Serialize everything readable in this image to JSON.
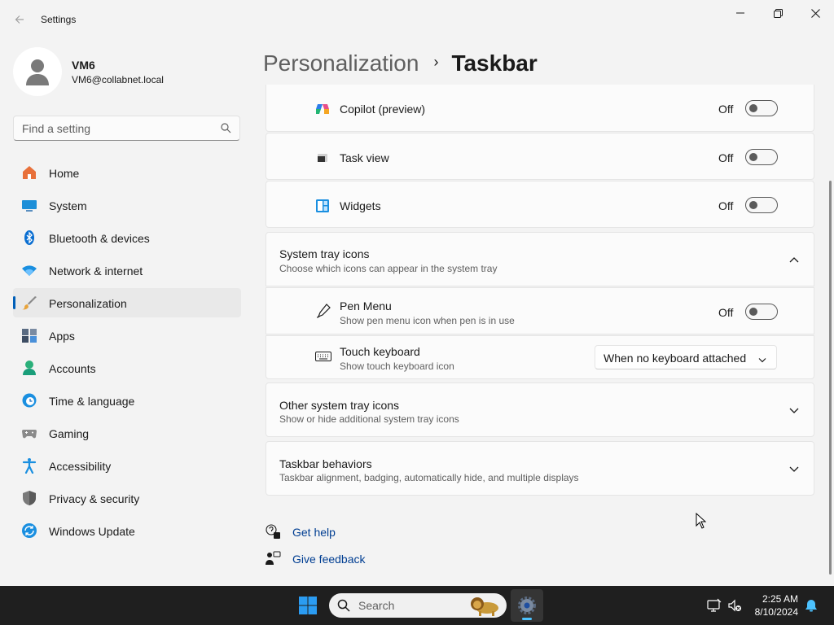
{
  "window": {
    "title": "Settings"
  },
  "profile": {
    "name": "VM6",
    "email": "VM6@collabnet.local"
  },
  "search": {
    "placeholder": "Find a setting"
  },
  "nav": {
    "items": [
      {
        "label": "Home",
        "icon": "home-icon"
      },
      {
        "label": "System",
        "icon": "system-icon"
      },
      {
        "label": "Bluetooth & devices",
        "icon": "bluetooth-icon"
      },
      {
        "label": "Network & internet",
        "icon": "wifi-icon"
      },
      {
        "label": "Personalization",
        "icon": "brush-icon",
        "active": true
      },
      {
        "label": "Apps",
        "icon": "apps-icon"
      },
      {
        "label": "Accounts",
        "icon": "accounts-icon"
      },
      {
        "label": "Time & language",
        "icon": "clock-globe-icon"
      },
      {
        "label": "Gaming",
        "icon": "gamepad-icon"
      },
      {
        "label": "Accessibility",
        "icon": "accessibility-icon"
      },
      {
        "label": "Privacy & security",
        "icon": "shield-icon"
      },
      {
        "label": "Windows Update",
        "icon": "update-icon"
      }
    ]
  },
  "breadcrumb": {
    "parent": "Personalization",
    "separator": "›",
    "current": "Taskbar"
  },
  "taskbar_items": [
    {
      "label": "Copilot (preview)",
      "state": "Off",
      "on": false,
      "icon": "copilot-icon"
    },
    {
      "label": "Task view",
      "state": "Off",
      "on": false,
      "icon": "task-view-icon"
    },
    {
      "label": "Widgets",
      "state": "Off",
      "on": false,
      "icon": "widgets-icon"
    }
  ],
  "system_tray": {
    "title": "System tray icons",
    "subtitle": "Choose which icons can appear in the system tray",
    "expanded": true,
    "pen_menu": {
      "label": "Pen Menu",
      "subtitle": "Show pen menu icon when pen is in use",
      "state": "Off",
      "on": false
    },
    "touch_keyboard": {
      "label": "Touch keyboard",
      "subtitle": "Show touch keyboard icon",
      "value": "When no keyboard attached"
    }
  },
  "other_tray": {
    "title": "Other system tray icons",
    "subtitle": "Show or hide additional system tray icons"
  },
  "behaviors": {
    "title": "Taskbar behaviors",
    "subtitle": "Taskbar alignment, badging, automatically hide, and multiple displays"
  },
  "help": {
    "get_help": "Get help",
    "give_feedback": "Give feedback"
  },
  "os_taskbar": {
    "search_label": "Search",
    "time": "2:25 AM",
    "date": "8/10/2024"
  },
  "colors": {
    "accent": "#005fb8",
    "link": "#003e92",
    "taskbar_bg": "#1f1f1f"
  }
}
